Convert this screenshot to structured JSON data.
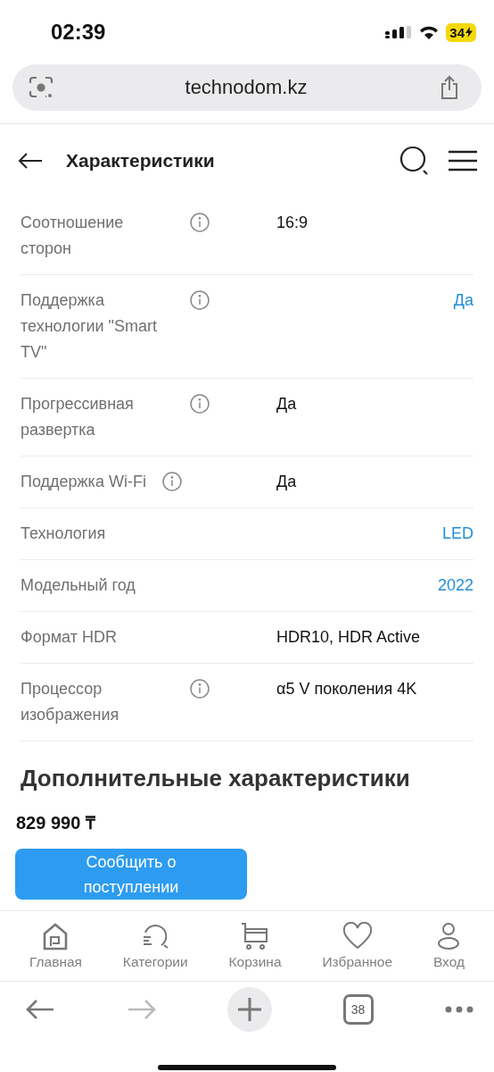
{
  "status_bar": {
    "time": "02:39",
    "battery": "34"
  },
  "browser": {
    "url": "technodom.kz",
    "tab_count": "38"
  },
  "header": {
    "title": "Характеристики"
  },
  "specs": [
    {
      "name": "Соотношение сторон",
      "info": true,
      "value": "16:9",
      "kind": "text"
    },
    {
      "name": "Поддержка технологии \"Smart TV\"",
      "info": true,
      "value": "Да",
      "kind": "link"
    },
    {
      "name": "Прогрессивная развертка",
      "info": true,
      "value": "Да",
      "kind": "text"
    },
    {
      "name": "Поддержка Wi-Fi",
      "info": true,
      "value": "Да",
      "kind": "text"
    },
    {
      "name": "Технология",
      "info": false,
      "value": "LED",
      "kind": "link"
    },
    {
      "name": "Модельный год",
      "info": false,
      "value": "2022",
      "kind": "link"
    },
    {
      "name": "Формат HDR",
      "info": false,
      "value": "HDR10, HDR Active",
      "kind": "text"
    },
    {
      "name": "Процессор изображения",
      "info": true,
      "value": "α5 V поколения 4K",
      "kind": "text"
    }
  ],
  "section_title": "Дополнительные характеристики",
  "price": "829 990 ₸",
  "notify_button": "Сообщить о поступлении",
  "bottom_nav": [
    {
      "label": "Главная",
      "kind": "home"
    },
    {
      "label": "Категории",
      "kind": "categories"
    },
    {
      "label": "Корзина",
      "kind": "cart"
    },
    {
      "label": "Избранное",
      "kind": "favorites"
    },
    {
      "label": "Вход",
      "kind": "login"
    }
  ]
}
